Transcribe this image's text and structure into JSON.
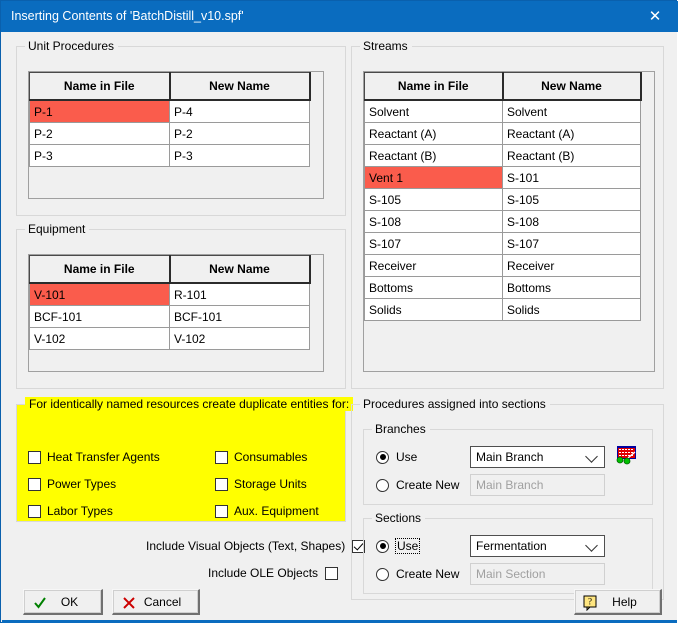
{
  "window": {
    "title": "Inserting Contents of 'BatchDistill_v10.spf'",
    "close_label": "✕",
    "titlebar_color": "#0a6cbf"
  },
  "colors": {
    "accent": "#0a6cbf",
    "highlight_row": "#fa5c4c",
    "panel_yellow": "#ffff00",
    "dialog_bg": "#f0f0f0"
  },
  "tables": {
    "columns": [
      "Name in File",
      "New Name"
    ],
    "unit_procedures": {
      "legend": "Unit Procedures",
      "rows": [
        {
          "name_in_file": "P-1",
          "new_name": "P-4",
          "selected": true
        },
        {
          "name_in_file": "P-2",
          "new_name": "P-2",
          "selected": false
        },
        {
          "name_in_file": "P-3",
          "new_name": "P-3",
          "selected": false
        }
      ]
    },
    "equipment": {
      "legend": "Equipment",
      "rows": [
        {
          "name_in_file": "V-101",
          "new_name": "R-101",
          "selected": true
        },
        {
          "name_in_file": "BCF-101",
          "new_name": "BCF-101",
          "selected": false
        },
        {
          "name_in_file": "V-102",
          "new_name": "V-102",
          "selected": false
        }
      ]
    },
    "streams": {
      "legend": "Streams",
      "rows": [
        {
          "name_in_file": "Solvent",
          "new_name": "Solvent",
          "selected": false
        },
        {
          "name_in_file": "Reactant (A)",
          "new_name": "Reactant (A)",
          "selected": false
        },
        {
          "name_in_file": "Reactant (B)",
          "new_name": "Reactant (B)",
          "selected": false
        },
        {
          "name_in_file": "Vent 1",
          "new_name": "S-101",
          "selected": true
        },
        {
          "name_in_file": "S-105",
          "new_name": "S-105",
          "selected": false
        },
        {
          "name_in_file": "S-108",
          "new_name": "S-108",
          "selected": false
        },
        {
          "name_in_file": "S-107",
          "new_name": "S-107",
          "selected": false
        },
        {
          "name_in_file": "Receiver",
          "new_name": "Receiver",
          "selected": false
        },
        {
          "name_in_file": "Bottoms",
          "new_name": "Bottoms",
          "selected": false
        },
        {
          "name_in_file": "Solids",
          "new_name": "Solids",
          "selected": false
        }
      ]
    }
  },
  "duplicates_panel": {
    "legend": "For identically named resources create duplicate entities for:",
    "items": [
      {
        "label": "Heat Transfer Agents",
        "checked": false
      },
      {
        "label": "Power Types",
        "checked": false
      },
      {
        "label": "Labor Types",
        "checked": false
      },
      {
        "label": "Consumables",
        "checked": false
      },
      {
        "label": "Storage Units",
        "checked": false
      },
      {
        "label": "Aux. Equipment",
        "checked": false
      }
    ]
  },
  "include_options": [
    {
      "label": "Include Visual Objects (Text, Shapes)",
      "checked": true
    },
    {
      "label": "Include OLE Objects",
      "checked": false
    }
  ],
  "sections_panel": {
    "legend": "Procedures assigned into sections",
    "branches": {
      "legend": "Branches",
      "use_label": "Use",
      "use_selected": true,
      "combo_value": "Main Branch",
      "create_new_label": "Create New",
      "create_new_selected": false,
      "textbox_placeholder": "Main Branch",
      "icon": "branch-editor-icon"
    },
    "sections": {
      "legend": "Sections",
      "use_label": "Use",
      "use_selected": true,
      "use_focused": true,
      "combo_value": "Fermentation",
      "create_new_label": "Create New",
      "create_new_selected": false,
      "textbox_placeholder": "Main Section"
    }
  },
  "buttons": {
    "ok": {
      "label": "OK",
      "icon": "check-icon"
    },
    "cancel": {
      "label": "Cancel",
      "icon": "cross-icon"
    },
    "help": {
      "label": "Help",
      "icon": "question-balloon-icon"
    }
  }
}
